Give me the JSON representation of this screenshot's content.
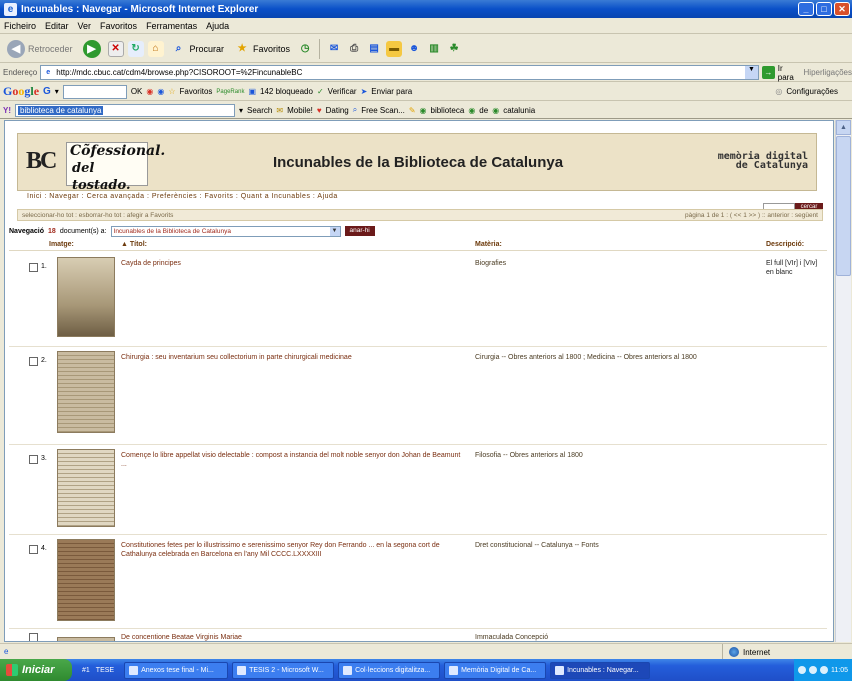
{
  "window": {
    "title": "Incunables : Navegar - Microsoft Internet Explorer"
  },
  "menu": [
    "Ficheiro",
    "Editar",
    "Ver",
    "Favoritos",
    "Ferramentas",
    "Ajuda"
  ],
  "toolbar": {
    "back": "Retroceder",
    "search": "Procurar",
    "favorites": "Favoritos"
  },
  "address": {
    "label": "Endereço",
    "url": "http://mdc.cbuc.cat/cdm4/browse.php?CISOROOT=%2FincunableBC",
    "go": "Ir para",
    "links": "Hiperligações"
  },
  "google_toolbar": {
    "logo": [
      "G",
      "o",
      "o",
      "g",
      "l",
      "e"
    ],
    "letter": "G",
    "ok": "OK",
    "favoritos": "Favoritos",
    "pagerank": "PageRank",
    "blocked": "142 bloqueado",
    "verify": "Verificar",
    "send": "Enviar para",
    "settings": "Configurações"
  },
  "second_toolbar": {
    "input": "biblioteca de catalunya",
    "search": "Search",
    "mobile": "Mobile!",
    "dating": "Dating",
    "freescan": "Free Scan...",
    "h1": "biblioteca",
    "h2": "de",
    "h3": "catalunia"
  },
  "page": {
    "banner_title": "Incunables de la Biblioteca de Catalunya",
    "bc_logo": "BC",
    "book_line1": "Cõfessional.",
    "book_line2": "del tostado.",
    "mdc_line1": "memòria digital",
    "mdc_line2": "de Catalunya",
    "nav": "Inici : Navegar : Cerca avançada : Preferències : Favorits : Quant a Incunables : Ajuda",
    "search_button": "cercar",
    "selection_bar": "seleccionar-ho tot : esborrar-ho tot : afegir a Favorits",
    "pager": "pàgina 1 de 1 : ( << 1 >> ) :: anterior : següent",
    "navegacio_label": "Navegació",
    "doc_count": "18",
    "doc_suffix": "document(s) a:",
    "collection": "Incunables de la Biblioteca de Catalunya",
    "go_button": "anar-hi",
    "headers": {
      "image": "Imatge:",
      "title": "▲ Títol:",
      "subject": "Matèria:",
      "description": "Descripció:"
    }
  },
  "rows": [
    {
      "num": "1.",
      "title": "Cayda de principes",
      "subject": "Biografies",
      "description": "El full [VIr] i [VIv] en blanc"
    },
    {
      "num": "2.",
      "title": "Chirurgia : seu inventarium seu collectorium in parte chirurgicali medicinae",
      "subject": "Cirurgia -- Obres anteriors al 1800 ; Medicina -- Obres anteriors al 1800",
      "description": ""
    },
    {
      "num": "3.",
      "title": "Començe lo libre appellat visio delectable : compost a instancia del molt noble senyor don Johan de Beamunt ...",
      "subject": "Filosofia -- Obres anteriors al 1800",
      "description": ""
    },
    {
      "num": "4.",
      "title": "Constitutiones fetes per lo illustrissimo e serenissimo senyor Rey don Ferrando ... en la segona cort de Cathalunya celebrada en Barcelona en l'any Mil CCCC.LXXXXIII",
      "subject": "Dret constitucional -- Catalunya -- Fonts",
      "description": ""
    },
    {
      "num": "5.",
      "title": "De concentione Beatae Virginis Mariae",
      "subject": "Immaculada Concepció",
      "description": ""
    }
  ],
  "status": {
    "zone": "Internet"
  },
  "taskbar": {
    "start": "Iniciar",
    "quick1": "#1",
    "quick2": "TESE",
    "tasks": [
      "Anexos tese final - Mi...",
      "TESIS 2 - Microsoft W...",
      "Col·leccions digitalitza...",
      "Memòria Digital de Ca...",
      "Incunables : Navegar..."
    ],
    "clock": "11:05"
  }
}
